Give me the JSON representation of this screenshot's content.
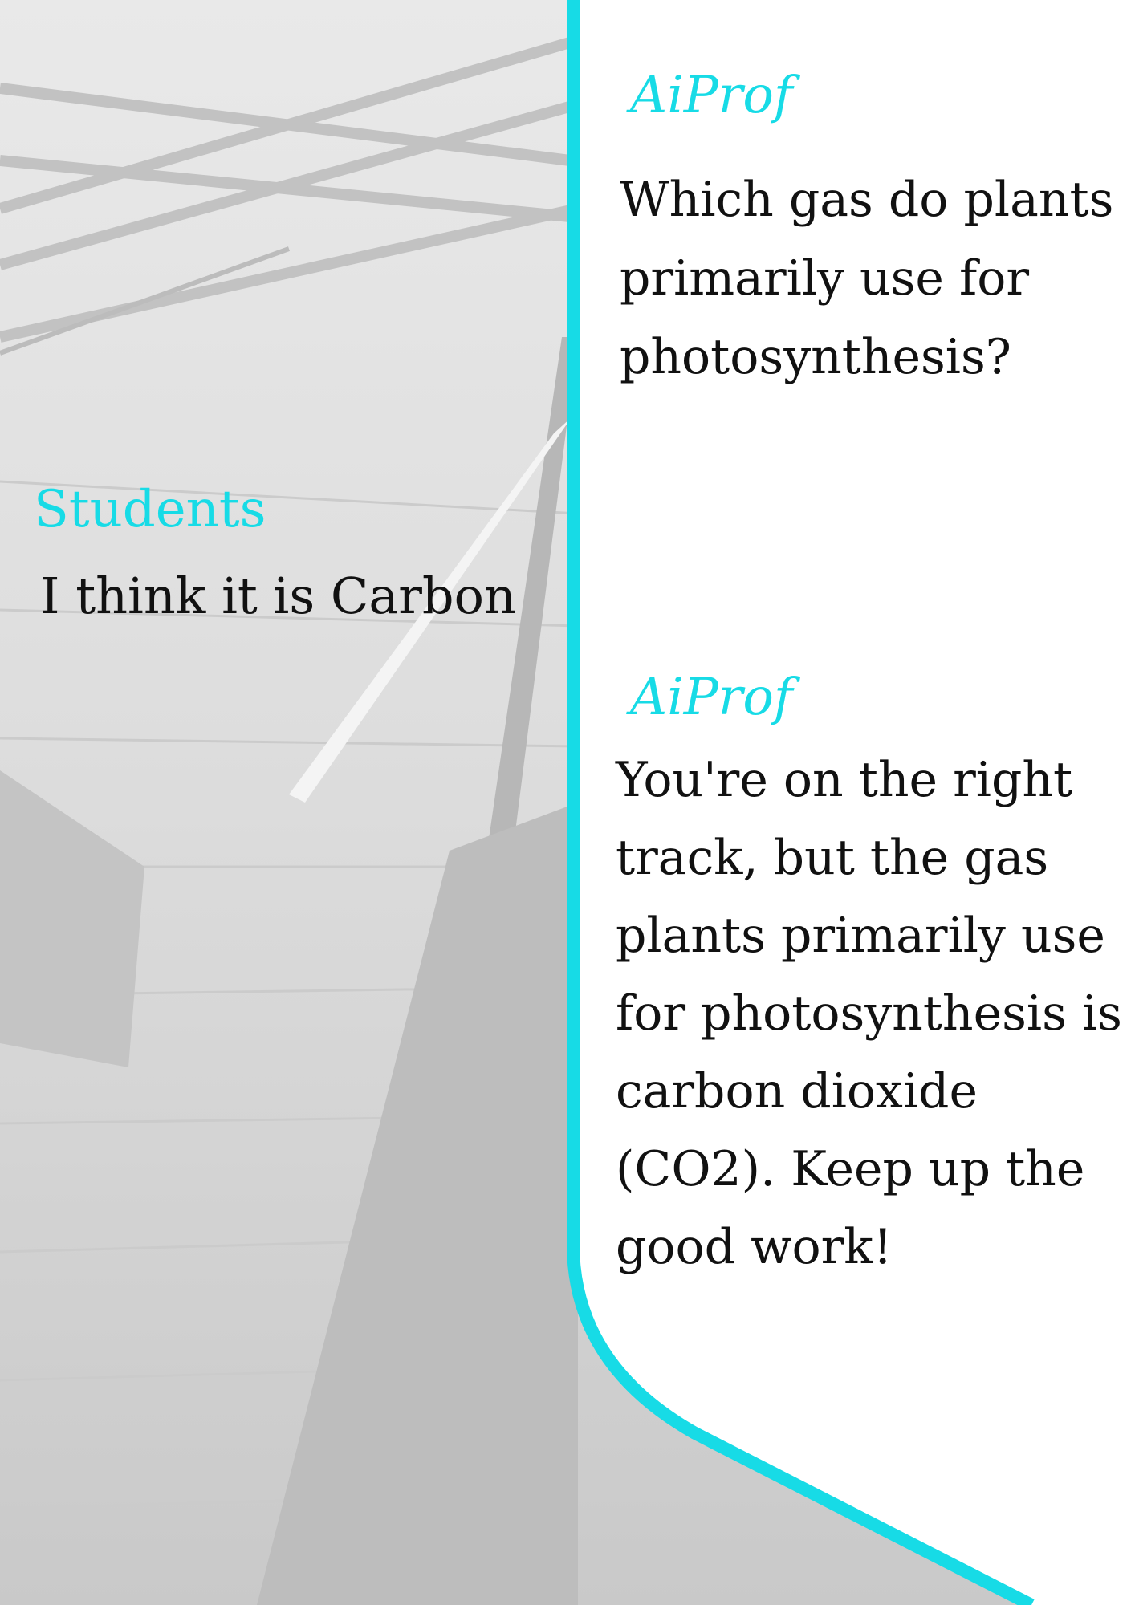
{
  "colors": {
    "accent": "#17dbe6",
    "text": "#111111",
    "panel": "#ffffff",
    "background": "#d7d7d7"
  },
  "background": {
    "image": "building-facade-grayscale"
  },
  "conversation": {
    "messages": [
      {
        "speaker": "AiProf",
        "text": "Which gas do plants primarily use for photosynthesis?"
      },
      {
        "speaker": "Students",
        "text": "I think it is Carbon"
      },
      {
        "speaker": "AiProf",
        "text": "You're on the right track, but the gas plants primarily use for photosynthesis is carbon dioxide (CO2). Keep up the good work!"
      }
    ]
  }
}
